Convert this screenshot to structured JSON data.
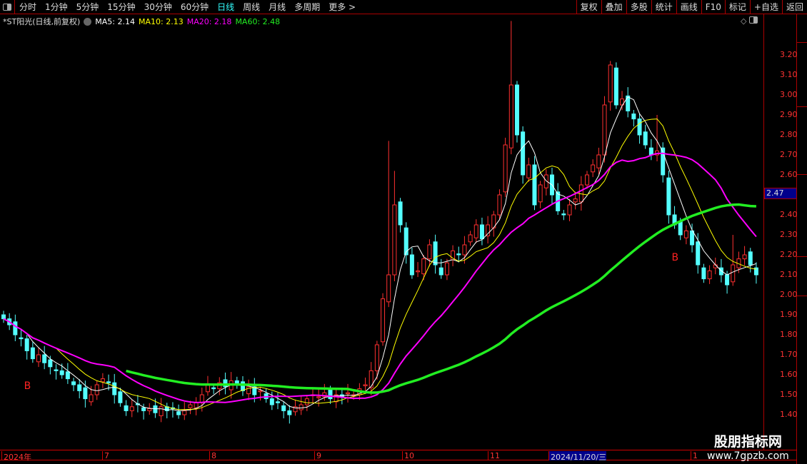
{
  "topbar": {
    "periods": [
      "分时",
      "1分钟",
      "5分钟",
      "15分钟",
      "30分钟",
      "60分钟",
      "日线",
      "周线",
      "月线",
      "多周期",
      "更多 >"
    ],
    "active": "日线",
    "tools": [
      "复权",
      "叠加",
      "多股",
      "统计",
      "画线",
      "F10",
      "标记",
      "+自选",
      "返回"
    ]
  },
  "legend": {
    "title": "*ST阳光(日线,前复权)",
    "ma5": "MA5: 2.14",
    "ma10": "MA10: 2.13",
    "ma20": "MA20: 2.18",
    "ma60": "MA60: 2.48"
  },
  "price_axis": {
    "labels": [
      "3.20",
      "3.10",
      "3.00",
      "2.90",
      "2.80",
      "2.70",
      "2.60",
      "2.40",
      "2.30",
      "2.20",
      "2.10",
      "2.00",
      "1.90",
      "1.80",
      "1.70",
      "1.60",
      "1.50",
      "1.40"
    ],
    "current": "2.47"
  },
  "date_axis": {
    "labels": [
      "2024年",
      "7",
      "8",
      "9",
      "10",
      "11",
      "2024/11/20/三",
      "1"
    ]
  },
  "markers": [
    {
      "index": 4,
      "label": "B"
    },
    {
      "index": 115,
      "label": "B"
    }
  ],
  "colors": {
    "up": "#ff3030",
    "down": "#54ffff",
    "ma5": "#ffffff",
    "ma10": "#ffff00",
    "ma20": "#ff00ff",
    "ma60": "#22ee22"
  },
  "watermark": {
    "name": "股朋指标网",
    "url": "www.7gpzb.com"
  },
  "chart_data": {
    "type": "candlestick",
    "ylim": [
      1.36,
      3.36
    ],
    "close": [
      1.88,
      1.85,
      1.8,
      1.78,
      1.72,
      1.68,
      1.7,
      1.66,
      1.64,
      1.62,
      1.6,
      1.58,
      1.55,
      1.52,
      1.48,
      1.5,
      1.55,
      1.58,
      1.56,
      1.5,
      1.46,
      1.42,
      1.44,
      1.45,
      1.42,
      1.43,
      1.41,
      1.44,
      1.42,
      1.43,
      1.4,
      1.42,
      1.45,
      1.46,
      1.5,
      1.55,
      1.53,
      1.56,
      1.54,
      1.57,
      1.55,
      1.52,
      1.54,
      1.5,
      1.52,
      1.48,
      1.45,
      1.46,
      1.42,
      1.4,
      1.44,
      1.45,
      1.48,
      1.5,
      1.49,
      1.51,
      1.48,
      1.5,
      1.49,
      1.51,
      1.5,
      1.53,
      1.55,
      1.62,
      1.75,
      1.98,
      2.1,
      2.45,
      2.35,
      2.2,
      2.1,
      2.12,
      2.18,
      2.25,
      2.15,
      2.1,
      2.16,
      2.22,
      2.2,
      2.25,
      2.3,
      2.35,
      2.28,
      2.35,
      2.4,
      2.5,
      2.75,
      3.05,
      2.8,
      2.6,
      2.65,
      2.45,
      2.55,
      2.6,
      2.5,
      2.42,
      2.4,
      2.45,
      2.48,
      2.55,
      2.6,
      2.65,
      2.7,
      2.95,
      3.15,
      2.95,
      2.98,
      2.92,
      2.88,
      2.8,
      2.75,
      2.7,
      2.72,
      2.6,
      2.4,
      2.35,
      2.3,
      2.32,
      2.25,
      2.15,
      2.08,
      2.12,
      2.15,
      2.1,
      2.05,
      2.15,
      2.18,
      2.2,
      2.15,
      2.1
    ],
    "high_overrides": {
      "66": 2.77,
      "67": 2.62,
      "87": 3.37,
      "104": 3.17,
      "106": 3.02,
      "112": 2.9,
      "125": 2.3
    }
  }
}
